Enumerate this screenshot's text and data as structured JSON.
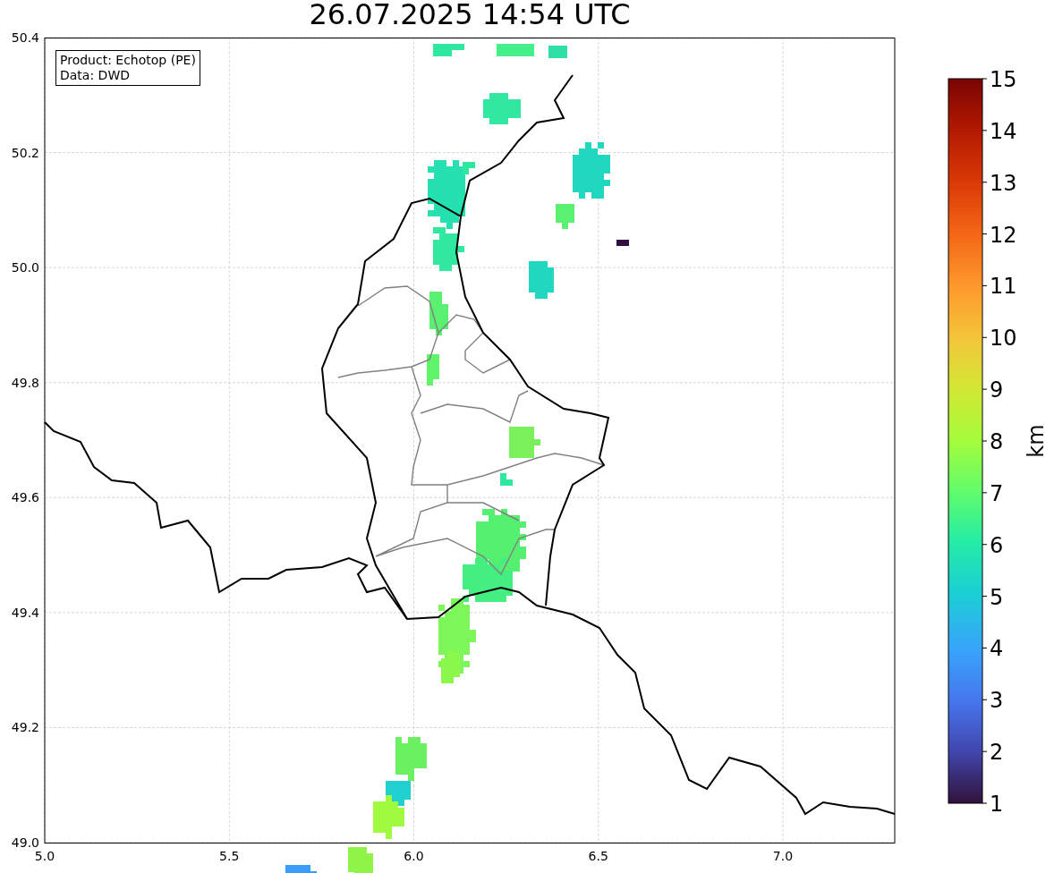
{
  "title": "26.07.2025 14:54 UTC",
  "legend_box": {
    "lines": [
      "Product: Echotop (PE)",
      "Data: DWD"
    ]
  },
  "x_ticks": [
    "5.0",
    "5.5",
    "6.0",
    "6.5",
    "7.0"
  ],
  "y_ticks": [
    "50.4",
    "50.2",
    "50.0",
    "49.8",
    "49.6",
    "49.4",
    "49.2",
    "49.0"
  ],
  "colorbar": {
    "label": "km",
    "ticks": [
      "15",
      "14",
      "13",
      "12",
      "11",
      "10",
      "9",
      "8",
      "7",
      "6",
      "5",
      "4",
      "3",
      "2",
      "1"
    ]
  }
}
